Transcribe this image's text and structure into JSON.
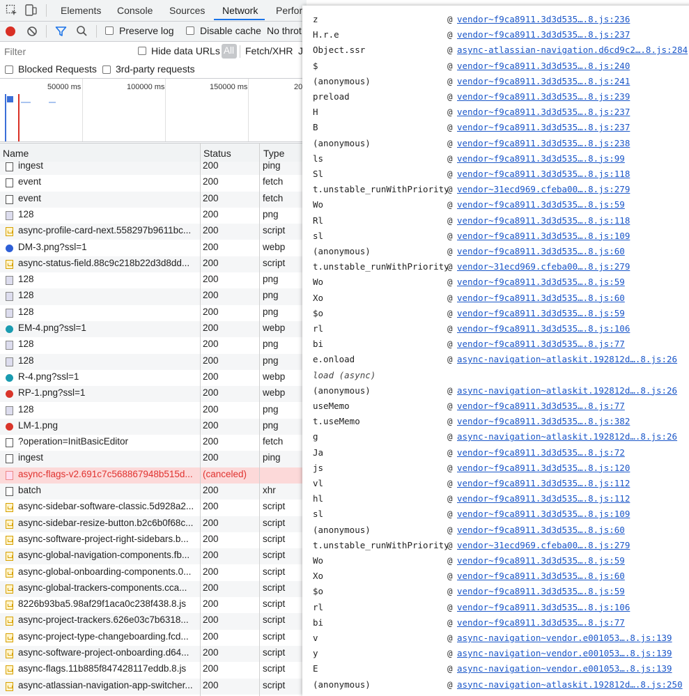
{
  "tabs": [
    "Elements",
    "Console",
    "Sources",
    "Network",
    "Perfor"
  ],
  "active_tab": "Network",
  "toolbar": {
    "preserve_log": "Preserve log",
    "disable_cache": "Disable cache",
    "throttling": "No throt"
  },
  "filter": {
    "placeholder": "Filter",
    "hide_data_urls": "Hide data URLs",
    "all": "All",
    "fetch_xhr": "Fetch/XHR",
    "js": "J"
  },
  "blocked": {
    "blocked_requests": "Blocked Requests",
    "third_party": "3rd-party requests"
  },
  "overview_ticks": [
    "50000 ms",
    "100000 ms",
    "150000 ms",
    "20"
  ],
  "columns": {
    "name": "Name",
    "status": "Status",
    "type": "Type"
  },
  "requests": [
    {
      "name": "ingest",
      "status": "200",
      "type": "ping",
      "icon": "doc"
    },
    {
      "name": "event",
      "status": "200",
      "type": "fetch",
      "icon": "doc"
    },
    {
      "name": "event",
      "status": "200",
      "type": "fetch",
      "icon": "doc"
    },
    {
      "name": "128",
      "status": "200",
      "type": "png",
      "icon": "img"
    },
    {
      "name": "async-profile-card-next.558297b9611bc...",
      "status": "200",
      "type": "script",
      "icon": "script"
    },
    {
      "name": "DM-3.png?ssl=1",
      "status": "200",
      "type": "webp",
      "icon": "webp",
      "color": "#2e5fd6"
    },
    {
      "name": "async-status-field.88c9c218b22d3d8dd...",
      "status": "200",
      "type": "script",
      "icon": "script"
    },
    {
      "name": "128",
      "status": "200",
      "type": "png",
      "icon": "img"
    },
    {
      "name": "128",
      "status": "200",
      "type": "png",
      "icon": "img"
    },
    {
      "name": "128",
      "status": "200",
      "type": "png",
      "icon": "img"
    },
    {
      "name": "EM-4.png?ssl=1",
      "status": "200",
      "type": "webp",
      "icon": "webp",
      "color": "#1a9bb0"
    },
    {
      "name": "128",
      "status": "200",
      "type": "png",
      "icon": "img"
    },
    {
      "name": "128",
      "status": "200",
      "type": "png",
      "icon": "img"
    },
    {
      "name": "R-4.png?ssl=1",
      "status": "200",
      "type": "webp",
      "icon": "webp",
      "color": "#1a9bb0"
    },
    {
      "name": "RP-1.png?ssl=1",
      "status": "200",
      "type": "webp",
      "icon": "webp",
      "color": "#d9352a"
    },
    {
      "name": "128",
      "status": "200",
      "type": "png",
      "icon": "img"
    },
    {
      "name": "LM-1.png",
      "status": "200",
      "type": "png",
      "icon": "webp",
      "color": "#d9352a"
    },
    {
      "name": "?operation=InitBasicEditor",
      "status": "200",
      "type": "fetch",
      "icon": "doc"
    },
    {
      "name": "ingest",
      "status": "200",
      "type": "ping",
      "icon": "doc"
    },
    {
      "name": "async-flags-v2.691c7c568867948b515d...",
      "status": "(canceled)",
      "type": "",
      "icon": "doc",
      "error": true
    },
    {
      "name": "batch",
      "status": "200",
      "type": "xhr",
      "icon": "doc"
    },
    {
      "name": "async-sidebar-software-classic.5d928a2...",
      "status": "200",
      "type": "script",
      "icon": "script"
    },
    {
      "name": "async-sidebar-resize-button.b2c6b0f68c...",
      "status": "200",
      "type": "script",
      "icon": "script"
    },
    {
      "name": "async-software-project-right-sidebars.b...",
      "status": "200",
      "type": "script",
      "icon": "script"
    },
    {
      "name": "async-global-navigation-components.fb...",
      "status": "200",
      "type": "script",
      "icon": "script"
    },
    {
      "name": "async-global-onboarding-components.0...",
      "status": "200",
      "type": "script",
      "icon": "script"
    },
    {
      "name": "async-global-trackers-components.cca...",
      "status": "200",
      "type": "script",
      "icon": "script"
    },
    {
      "name": "8226b93ba5.98af29f1aca0c238f438.8.js",
      "status": "200",
      "type": "script",
      "icon": "script"
    },
    {
      "name": "async-project-trackers.626e03c7b6318...",
      "status": "200",
      "type": "script",
      "icon": "script"
    },
    {
      "name": "async-project-type-changeboarding.fcd...",
      "status": "200",
      "type": "script",
      "icon": "script"
    },
    {
      "name": "async-software-project-onboarding.d64...",
      "status": "200",
      "type": "script",
      "icon": "script"
    },
    {
      "name": "async-flags.11b885f847428117eddb.8.js",
      "status": "200",
      "type": "script",
      "icon": "script"
    },
    {
      "name": "async-atlassian-navigation-app-switcher...",
      "status": "200",
      "type": "script",
      "icon": "script"
    }
  ],
  "stack": [
    {
      "fn": "z",
      "src": "vendor~f9ca8911.3d3d535….8.js:236"
    },
    {
      "fn": "H.r.e",
      "src": "vendor~f9ca8911.3d3d535….8.js:237"
    },
    {
      "fn": "Object.ssr",
      "src": "async-atlassian-navigation.d6cd9c2….8.js:284"
    },
    {
      "fn": "$",
      "src": "vendor~f9ca8911.3d3d535….8.js:240"
    },
    {
      "fn": "(anonymous)",
      "src": "vendor~f9ca8911.3d3d535….8.js:241"
    },
    {
      "fn": "preload",
      "src": "vendor~f9ca8911.3d3d535….8.js:239"
    },
    {
      "fn": "H",
      "src": "vendor~f9ca8911.3d3d535….8.js:237"
    },
    {
      "fn": "B",
      "src": "vendor~f9ca8911.3d3d535….8.js:237"
    },
    {
      "fn": "(anonymous)",
      "src": "vendor~f9ca8911.3d3d535….8.js:238"
    },
    {
      "fn": "ls",
      "src": "vendor~f9ca8911.3d3d535….8.js:99"
    },
    {
      "fn": "Sl",
      "src": "vendor~f9ca8911.3d3d535….8.js:118"
    },
    {
      "fn": "t.unstable_runWithPriority",
      "src": "vendor~31ecd969.cfeba00….8.js:279"
    },
    {
      "fn": "Wo",
      "src": "vendor~f9ca8911.3d3d535….8.js:59"
    },
    {
      "fn": "Rl",
      "src": "vendor~f9ca8911.3d3d535….8.js:118"
    },
    {
      "fn": "sl",
      "src": "vendor~f9ca8911.3d3d535….8.js:109"
    },
    {
      "fn": "(anonymous)",
      "src": "vendor~f9ca8911.3d3d535….8.js:60"
    },
    {
      "fn": "t.unstable_runWithPriority",
      "src": "vendor~31ecd969.cfeba00….8.js:279"
    },
    {
      "fn": "Wo",
      "src": "vendor~f9ca8911.3d3d535….8.js:59"
    },
    {
      "fn": "Xo",
      "src": "vendor~f9ca8911.3d3d535….8.js:60"
    },
    {
      "fn": "$o",
      "src": "vendor~f9ca8911.3d3d535….8.js:59"
    },
    {
      "fn": "rl",
      "src": "vendor~f9ca8911.3d3d535….8.js:106"
    },
    {
      "fn": "bi",
      "src": "vendor~f9ca8911.3d3d535….8.js:77"
    },
    {
      "fn": "e.onload",
      "src": "async-navigation~atlaskit.192812d….8.js:26"
    },
    {
      "fn": "load (async)",
      "src": "",
      "italic": true
    },
    {
      "fn": "(anonymous)",
      "src": "async-navigation~atlaskit.192812d….8.js:26"
    },
    {
      "fn": "useMemo",
      "src": "vendor~f9ca8911.3d3d535….8.js:77"
    },
    {
      "fn": "t.useMemo",
      "src": "vendor~f9ca8911.3d3d535….8.js:382"
    },
    {
      "fn": "g",
      "src": "async-navigation~atlaskit.192812d….8.js:26"
    },
    {
      "fn": "Ja",
      "src": "vendor~f9ca8911.3d3d535….8.js:72"
    },
    {
      "fn": "js",
      "src": "vendor~f9ca8911.3d3d535….8.js:120"
    },
    {
      "fn": "vl",
      "src": "vendor~f9ca8911.3d3d535….8.js:112"
    },
    {
      "fn": "hl",
      "src": "vendor~f9ca8911.3d3d535….8.js:112"
    },
    {
      "fn": "sl",
      "src": "vendor~f9ca8911.3d3d535….8.js:109"
    },
    {
      "fn": "(anonymous)",
      "src": "vendor~f9ca8911.3d3d535….8.js:60"
    },
    {
      "fn": "t.unstable_runWithPriority",
      "src": "vendor~31ecd969.cfeba00….8.js:279"
    },
    {
      "fn": "Wo",
      "src": "vendor~f9ca8911.3d3d535….8.js:59"
    },
    {
      "fn": "Xo",
      "src": "vendor~f9ca8911.3d3d535….8.js:60"
    },
    {
      "fn": "$o",
      "src": "vendor~f9ca8911.3d3d535….8.js:59"
    },
    {
      "fn": "rl",
      "src": "vendor~f9ca8911.3d3d535….8.js:106"
    },
    {
      "fn": "bi",
      "src": "vendor~f9ca8911.3d3d535….8.js:77"
    },
    {
      "fn": "v",
      "src": "async-navigation~vendor.e001053….8.js:139"
    },
    {
      "fn": "y",
      "src": "async-navigation~vendor.e001053….8.js:139"
    },
    {
      "fn": "E",
      "src": "async-navigation~vendor.e001053….8.js:139"
    },
    {
      "fn": "(anonymous)",
      "src": "async-navigation~atlaskit.192812d….8.js:250"
    }
  ],
  "at_symbol": "@"
}
